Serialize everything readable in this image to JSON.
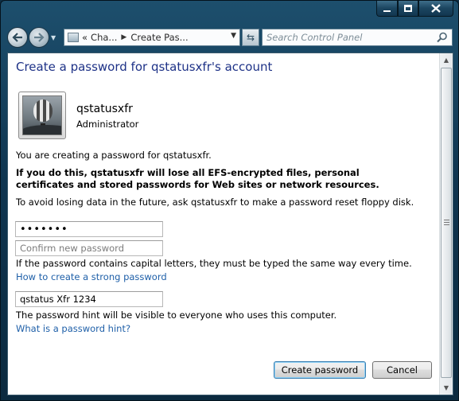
{
  "address": {
    "prefix": "«",
    "segments": [
      "Cha...",
      "Create Pas..."
    ]
  },
  "search": {
    "placeholder": "Search Control Panel"
  },
  "page": {
    "title": "Create a password for qstatusxfr's account",
    "user_name": "qstatusxfr",
    "user_role": "Administrator",
    "intro": "You are creating a password for qstatusxfr.",
    "warning": "If you do this, qstatusxfr will lose all EFS-encrypted files, personal certificates and stored passwords for Web sites or network resources.",
    "advice": "To avoid losing data in the future, ask qstatusxfr to make a password reset floppy disk."
  },
  "form": {
    "new_password_value": "•••••••",
    "confirm_placeholder": "Confirm new password",
    "case_note": "If the password contains capital letters, they must be typed the same way every time.",
    "strong_link": "How to create a strong password",
    "hint_value": "qstatus Xfr 1234",
    "hint_note": "The password hint will be visible to everyone who uses this computer.",
    "hint_link": "What is a password hint?"
  },
  "buttons": {
    "create": "Create password",
    "cancel": "Cancel"
  },
  "icons": {
    "back": "back-arrow-icon",
    "forward": "forward-arrow-icon",
    "refresh": "refresh-icon",
    "search": "search-icon",
    "control_panel": "control-panel-icon"
  },
  "colors": {
    "title": "#1e3287",
    "link": "#1e5fa8",
    "frame": "#0f3550"
  }
}
